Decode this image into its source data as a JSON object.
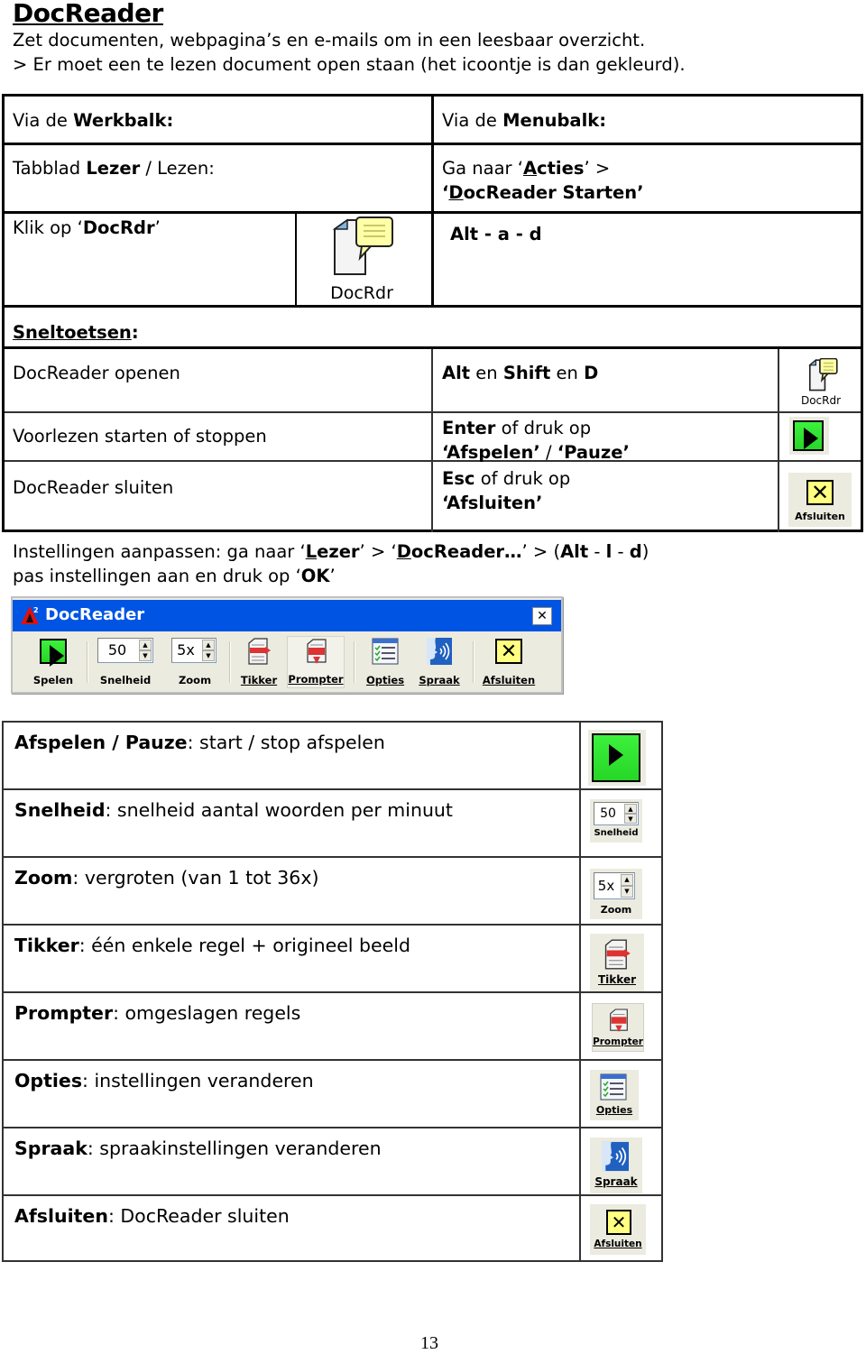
{
  "header": {
    "title": "DocReader",
    "intro_line1": "Zet documenten, webpagina’s en e-mails om in een leesbaar overzicht.",
    "intro_line2": "> Er moet een te lezen document open staan (het icoontje is dan gekleurd)."
  },
  "open_table": {
    "toolbar_header_prefix": "Via de ",
    "toolbar_header_bold": "Werkbalk:",
    "menubar_header_prefix": "Via de ",
    "menubar_header_bold": "Menubalk:",
    "tab_prefix": "Tabblad ",
    "tab_bold": "Lezer",
    "tab_suffix": " / Lezen:",
    "menu_goto_prefix": "Ga naar ‘",
    "menu_goto_underlined": "A",
    "menu_goto_bold_rest": "cties",
    "menu_goto_suffix": "’ >",
    "menu_start_open": "‘",
    "menu_start_underlined": "D",
    "menu_start_bold_rest": "ocReader Starten",
    "menu_start_close": "’",
    "click_prefix": "Klik op ‘",
    "click_bold": "DocRdr",
    "click_suffix": "’",
    "docrdr_icon_label": "DocRdr",
    "menu_shortcut": "Alt - a - d"
  },
  "shortcuts": {
    "heading": "Sneltoetsen",
    "heading_colon": ":",
    "rows": [
      {
        "action": "DocReader openen",
        "keys_parts": [
          {
            "text": "Alt",
            "bold": true
          },
          {
            "text": " en ",
            "bold": false
          },
          {
            "text": "Shift",
            "bold": true
          },
          {
            "text": " en ",
            "bold": false
          },
          {
            "text": "D",
            "bold": true
          }
        ],
        "icon": "docrdr-icon",
        "icon_label": "DocRdr"
      },
      {
        "action": "Voorlezen starten of stoppen",
        "line1_bold": "Enter",
        "line1_rest": " of druk op",
        "line2_bold1": "‘Afspelen’",
        "line2_sep": " / ",
        "line2_bold2": "‘Pauze’",
        "icon": "play-icon"
      },
      {
        "action": "DocReader sluiten",
        "line1_bold": "Esc",
        "line1_rest": " of druk op",
        "line2_bold1": "‘Afsluiten’",
        "icon": "close-x-icon",
        "icon_label": "Afsluiten"
      }
    ]
  },
  "settings": {
    "line1_prefix": "Instellingen aanpassen: ga naar ‘",
    "line1_lezer_u": "L",
    "line1_lezer_rest": "ezer",
    "line1_mid": "’ > ‘",
    "line1_doc_u": "D",
    "line1_doc_rest": "ocReader…",
    "line1_mid2": "’ > (",
    "line1_alt": "Alt",
    "line1_dash1": " - ",
    "line1_l": "l",
    "line1_dash2": " - ",
    "line1_d": "d",
    "line1_end": ")",
    "line2_prefix": "pas instellingen aan en druk op ‘",
    "line2_ok": "OK",
    "line2_end": "’"
  },
  "window": {
    "title": "DocReader",
    "close_glyph": "✕",
    "toolbar": {
      "play_label": "Spelen",
      "speed_value": "50",
      "speed_label": "Snelheid",
      "zoom_value": "5x",
      "zoom_label": "Zoom",
      "tikker_label": "Tikker",
      "prompter_label": "Prompter",
      "opties_label": "Opties",
      "spraak_label": "Spraak",
      "afsluiten_label": "Afsluiten"
    }
  },
  "functions": [
    {
      "name": "Afspelen / Pauze",
      "desc": ": start / stop afspelen",
      "icon": "play-icon"
    },
    {
      "name": "Snelheid",
      "desc": ": snelheid aantal woorden per minuut",
      "icon": "speed-spinner-icon",
      "value": "50",
      "label": "Snelheid"
    },
    {
      "name": "Zoom",
      "desc": ": vergroten (van 1 tot 36x)",
      "icon": "zoom-spinner-icon",
      "value": "5x",
      "label": "Zoom"
    },
    {
      "name": "Tikker",
      "desc": ": één enkele regel + origineel beeld",
      "icon": "tikker-icon",
      "label": "Tikker"
    },
    {
      "name": "Prompter",
      "desc": ": omgeslagen regels",
      "icon": "prompter-icon",
      "label": "Prompter"
    },
    {
      "name": "Opties",
      "desc": ": instellingen veranderen",
      "icon": "opties-icon",
      "label": "Opties"
    },
    {
      "name": "Spraak",
      "desc": ": spraakinstellingen veranderen",
      "icon": "spraak-icon",
      "label": "Spraak"
    },
    {
      "name": "Afsluiten",
      "desc": ": DocReader sluiten",
      "icon": "close-x-icon",
      "label": "Afsluiten"
    }
  ],
  "footer": {
    "page_number": "13"
  },
  "colors": {
    "title_bar": "#0054e3",
    "play_green": "#33e633",
    "close_yellow": "#ffff80",
    "button_bg": "#ecebe0"
  }
}
